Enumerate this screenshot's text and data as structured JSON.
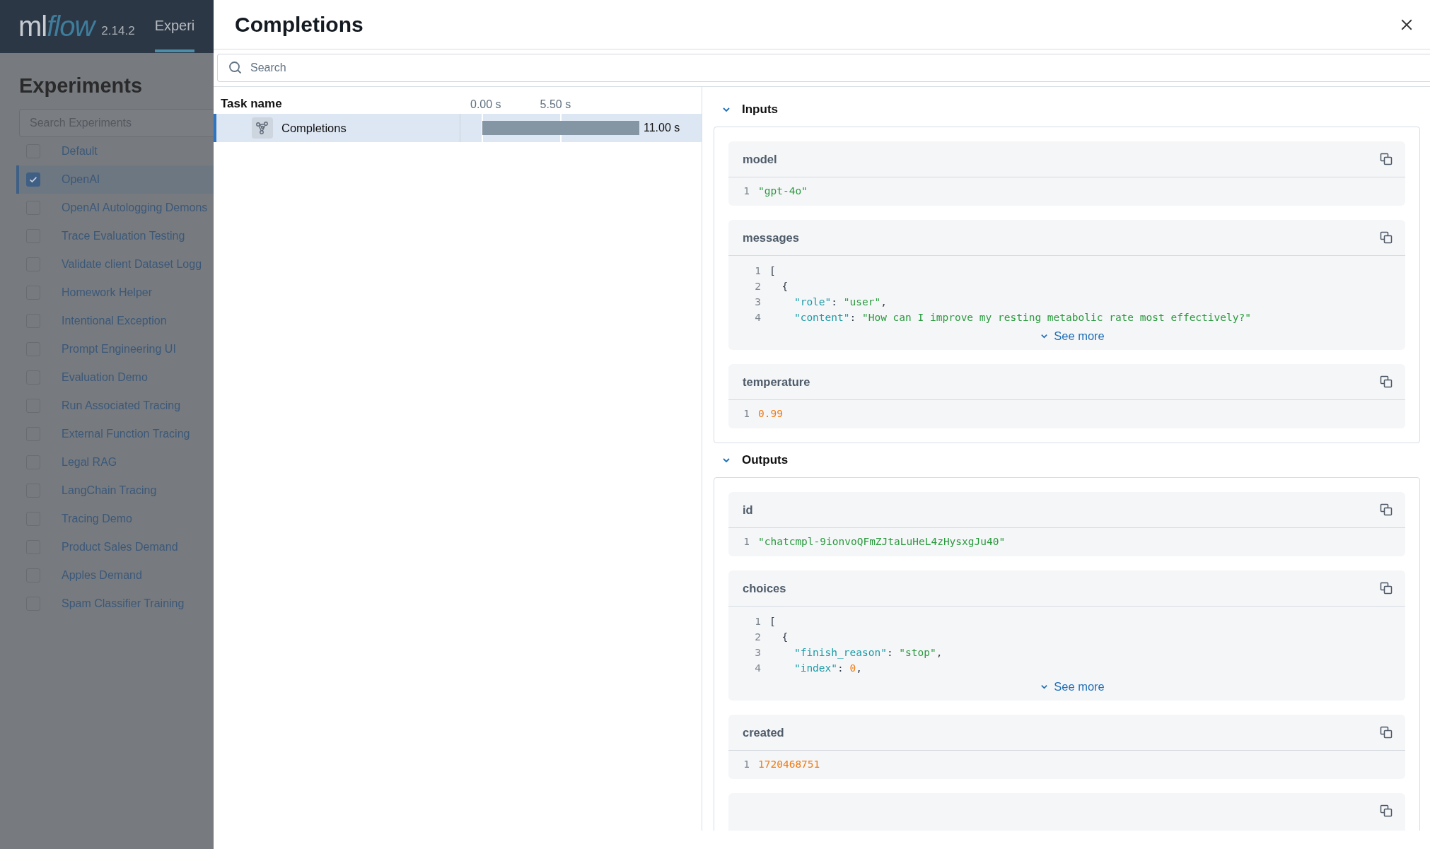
{
  "app_header": {
    "logo": [
      "ml",
      "flow"
    ],
    "version": "2.14.2",
    "nav_tab": "Experi"
  },
  "sidebar": {
    "title": "Experiments",
    "search": {
      "placeholder": "Search Experiments"
    },
    "items": [
      {
        "label": "Default",
        "checked": false,
        "selected": false
      },
      {
        "label": "OpenAI",
        "checked": true,
        "selected": true
      },
      {
        "label": "OpenAI Autologging Demons",
        "checked": false,
        "selected": false
      },
      {
        "label": "Trace Evaluation Testing",
        "checked": false,
        "selected": false
      },
      {
        "label": "Validate client Dataset Logg",
        "checked": false,
        "selected": false
      },
      {
        "label": "Homework Helper",
        "checked": false,
        "selected": false
      },
      {
        "label": "Intentional Exception",
        "checked": false,
        "selected": false
      },
      {
        "label": "Prompt Engineering UI",
        "checked": false,
        "selected": false
      },
      {
        "label": "Evaluation Demo",
        "checked": false,
        "selected": false
      },
      {
        "label": "Run Associated Tracing",
        "checked": false,
        "selected": false
      },
      {
        "label": "External Function Tracing",
        "checked": false,
        "selected": false
      },
      {
        "label": "Legal RAG",
        "checked": false,
        "selected": false
      },
      {
        "label": "LangChain Tracing",
        "checked": false,
        "selected": false
      },
      {
        "label": "Tracing Demo",
        "checked": false,
        "selected": false
      },
      {
        "label": "Product Sales Demand",
        "checked": false,
        "selected": false
      },
      {
        "label": "Apples Demand",
        "checked": false,
        "selected": false
      },
      {
        "label": "Spam Classifier Training",
        "checked": false,
        "selected": false
      }
    ]
  },
  "drawer": {
    "title": "Completions",
    "search": {
      "placeholder": "Search"
    },
    "timeline": {
      "column_header": "Task name",
      "ticks": [
        "0.00 s",
        "5.50 s"
      ],
      "spans": [
        {
          "name": "Completions",
          "duration": "11.00 s",
          "selected": true
        }
      ]
    },
    "sections": [
      {
        "title": "Inputs",
        "expanded": true,
        "fields": [
          {
            "kind": "value",
            "name": "model",
            "lines": [
              {
                "num": "1",
                "tokens": [
                  {
                    "kind": "string",
                    "text": "\"gpt-4o\""
                  }
                ]
              }
            ]
          },
          {
            "kind": "value",
            "name": "messages",
            "see_more": "See more",
            "lines": [
              {
                "num": "1",
                "tokens": [
                  {
                    "kind": "punct",
                    "text": "["
                  }
                ]
              },
              {
                "num": "2",
                "tokens": [
                  {
                    "kind": "punct",
                    "text": "  {"
                  }
                ]
              },
              {
                "num": "3",
                "tokens": [
                  {
                    "kind": "key",
                    "text": "    \"role\""
                  },
                  {
                    "kind": "punct",
                    "text": ": "
                  },
                  {
                    "kind": "string",
                    "text": "\"user\""
                  },
                  {
                    "kind": "punct",
                    "text": ","
                  }
                ]
              },
              {
                "num": "4",
                "tokens": [
                  {
                    "kind": "key",
                    "text": "    \"content\""
                  },
                  {
                    "kind": "punct",
                    "text": ": "
                  },
                  {
                    "kind": "string",
                    "text": "\"How can I improve my resting metabolic rate most effectively?\""
                  }
                ]
              }
            ]
          },
          {
            "kind": "value",
            "name": "temperature",
            "lines": [
              {
                "num": "1",
                "tokens": [
                  {
                    "kind": "number",
                    "text": "0.99"
                  }
                ]
              }
            ]
          }
        ]
      },
      {
        "title": "Outputs",
        "expanded": true,
        "fields": [
          {
            "kind": "value",
            "name": "id",
            "lines": [
              {
                "num": "1",
                "tokens": [
                  {
                    "kind": "string",
                    "text": "\"chatcmpl-9ionvoQFmZJtaLuHeL4zHysxgJu40\""
                  }
                ]
              }
            ]
          },
          {
            "kind": "value",
            "name": "choices",
            "see_more": "See more",
            "lines": [
              {
                "num": "1",
                "tokens": [
                  {
                    "kind": "punct",
                    "text": "["
                  }
                ]
              },
              {
                "num": "2",
                "tokens": [
                  {
                    "kind": "punct",
                    "text": "  {"
                  }
                ]
              },
              {
                "num": "3",
                "tokens": [
                  {
                    "kind": "key",
                    "text": "    \"finish_reason\""
                  },
                  {
                    "kind": "punct",
                    "text": ": "
                  },
                  {
                    "kind": "string",
                    "text": "\"stop\""
                  },
                  {
                    "kind": "punct",
                    "text": ","
                  }
                ]
              },
              {
                "num": "4",
                "tokens": [
                  {
                    "kind": "key",
                    "text": "    \"index\""
                  },
                  {
                    "kind": "punct",
                    "text": ": "
                  },
                  {
                    "kind": "number",
                    "text": "0"
                  },
                  {
                    "kind": "punct",
                    "text": ","
                  }
                ]
              }
            ]
          },
          {
            "kind": "value",
            "name": "created",
            "lines": [
              {
                "num": "1",
                "tokens": [
                  {
                    "kind": "number",
                    "text": "1720468751"
                  }
                ]
              }
            ]
          },
          {
            "kind": "partial"
          }
        ]
      }
    ]
  }
}
